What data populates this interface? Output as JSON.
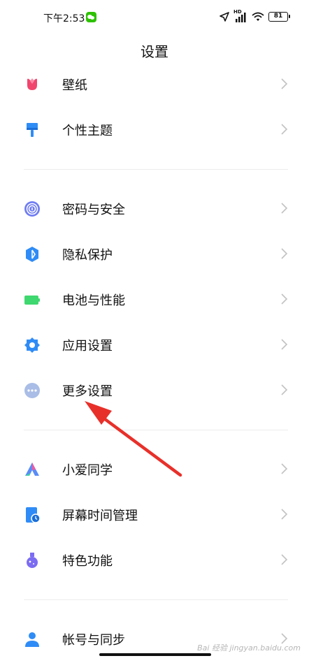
{
  "status_bar": {
    "time": "下午2:53",
    "network": "HD",
    "battery": "81"
  },
  "page": {
    "title": "设置"
  },
  "groups": [
    {
      "items": [
        {
          "label": "壁纸",
          "icon": "tulip-icon",
          "color": "#f0466e"
        },
        {
          "label": "个性主题",
          "icon": "paint-roller-icon",
          "color": "#2f8cf6"
        }
      ]
    },
    {
      "items": [
        {
          "label": "密码与安全",
          "icon": "fingerprint-icon",
          "color": "#6f7cf2"
        },
        {
          "label": "隐私保护",
          "icon": "privacy-shield-icon",
          "color": "#2f8cf6"
        },
        {
          "label": "电池与性能",
          "icon": "battery-icon",
          "color": "#3fd76f"
        },
        {
          "label": "应用设置",
          "icon": "gear-icon",
          "color": "#2f8cf6"
        },
        {
          "label": "更多设置",
          "icon": "more-dots-icon",
          "color": "#a9bde6"
        }
      ]
    },
    {
      "items": [
        {
          "label": "小爱同学",
          "icon": "xiaoai-icon",
          "color": "#5a8cf6"
        },
        {
          "label": "屏幕时间管理",
          "icon": "screen-time-icon",
          "color": "#2f8cf6"
        },
        {
          "label": "特色功能",
          "icon": "flask-icon",
          "color": "#7b6cf2"
        }
      ]
    },
    {
      "items": [
        {
          "label": "帐号与同步",
          "icon": "person-icon",
          "color": "#2f8cf6"
        }
      ]
    }
  ],
  "annotation": {
    "arrow_color": "#e8302a"
  },
  "watermark": "Bai 经验 jingyan.baidu.com"
}
